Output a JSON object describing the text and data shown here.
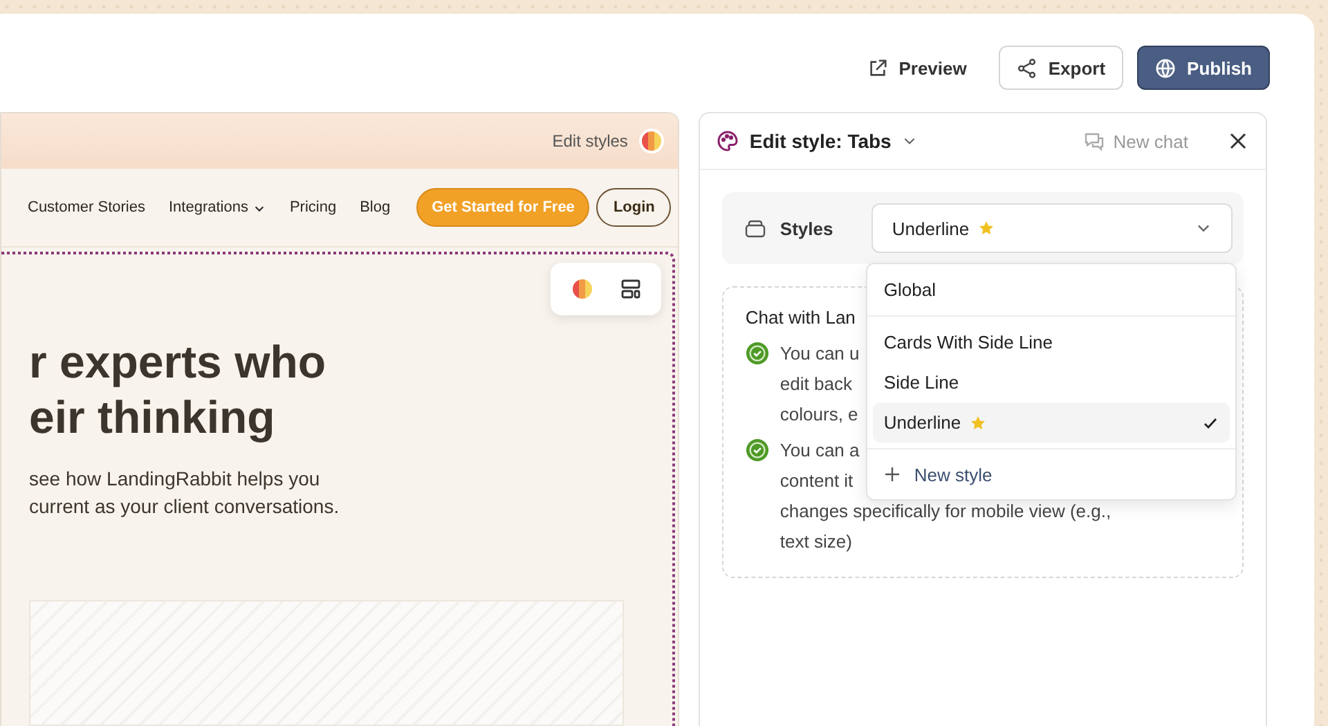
{
  "toolbar": {
    "buttons": [
      {
        "label": "Preview",
        "kind": "link"
      },
      {
        "label": "Export",
        "kind": "outline"
      },
      {
        "label": "Publish",
        "kind": "primary"
      }
    ]
  },
  "preview": {
    "edit_styles": "Edit styles",
    "nav": {
      "items": [
        {
          "label": "Customer Stories",
          "dropdown": false
        },
        {
          "label": "Integrations",
          "dropdown": true
        },
        {
          "label": "Pricing",
          "dropdown": false
        },
        {
          "label": "Blog",
          "dropdown": false
        }
      ],
      "cta": "Get Started for Free",
      "login": "Login"
    },
    "hero": {
      "heading": [
        "r experts who",
        "eir thinking"
      ],
      "body": [
        "see how LandingRabbit helps you",
        "current as your client conversations."
      ]
    }
  },
  "panel": {
    "title": "Edit style: Tabs",
    "new_chat": "New chat",
    "styles": {
      "label": "Styles",
      "value": "Underline",
      "value_starred": true
    },
    "dropdown": {
      "groups": [
        [
          {
            "label": "Global",
            "starred": false,
            "selected": false
          }
        ],
        [
          {
            "label": "Cards With Side Line",
            "starred": false,
            "selected": false
          },
          {
            "label": "Side Line",
            "starred": false,
            "selected": false
          },
          {
            "label": "Underline",
            "starred": true,
            "selected": true
          }
        ]
      ],
      "new_style": "New style"
    },
    "chat": {
      "title": "Chat with Lan",
      "bullets": [
        [
          "You can u",
          "edit back",
          "colours, e"
        ],
        [
          "You can a",
          "content it",
          "changes specifically for mobile view (e.g.,",
          "text size)"
        ]
      ]
    }
  }
}
